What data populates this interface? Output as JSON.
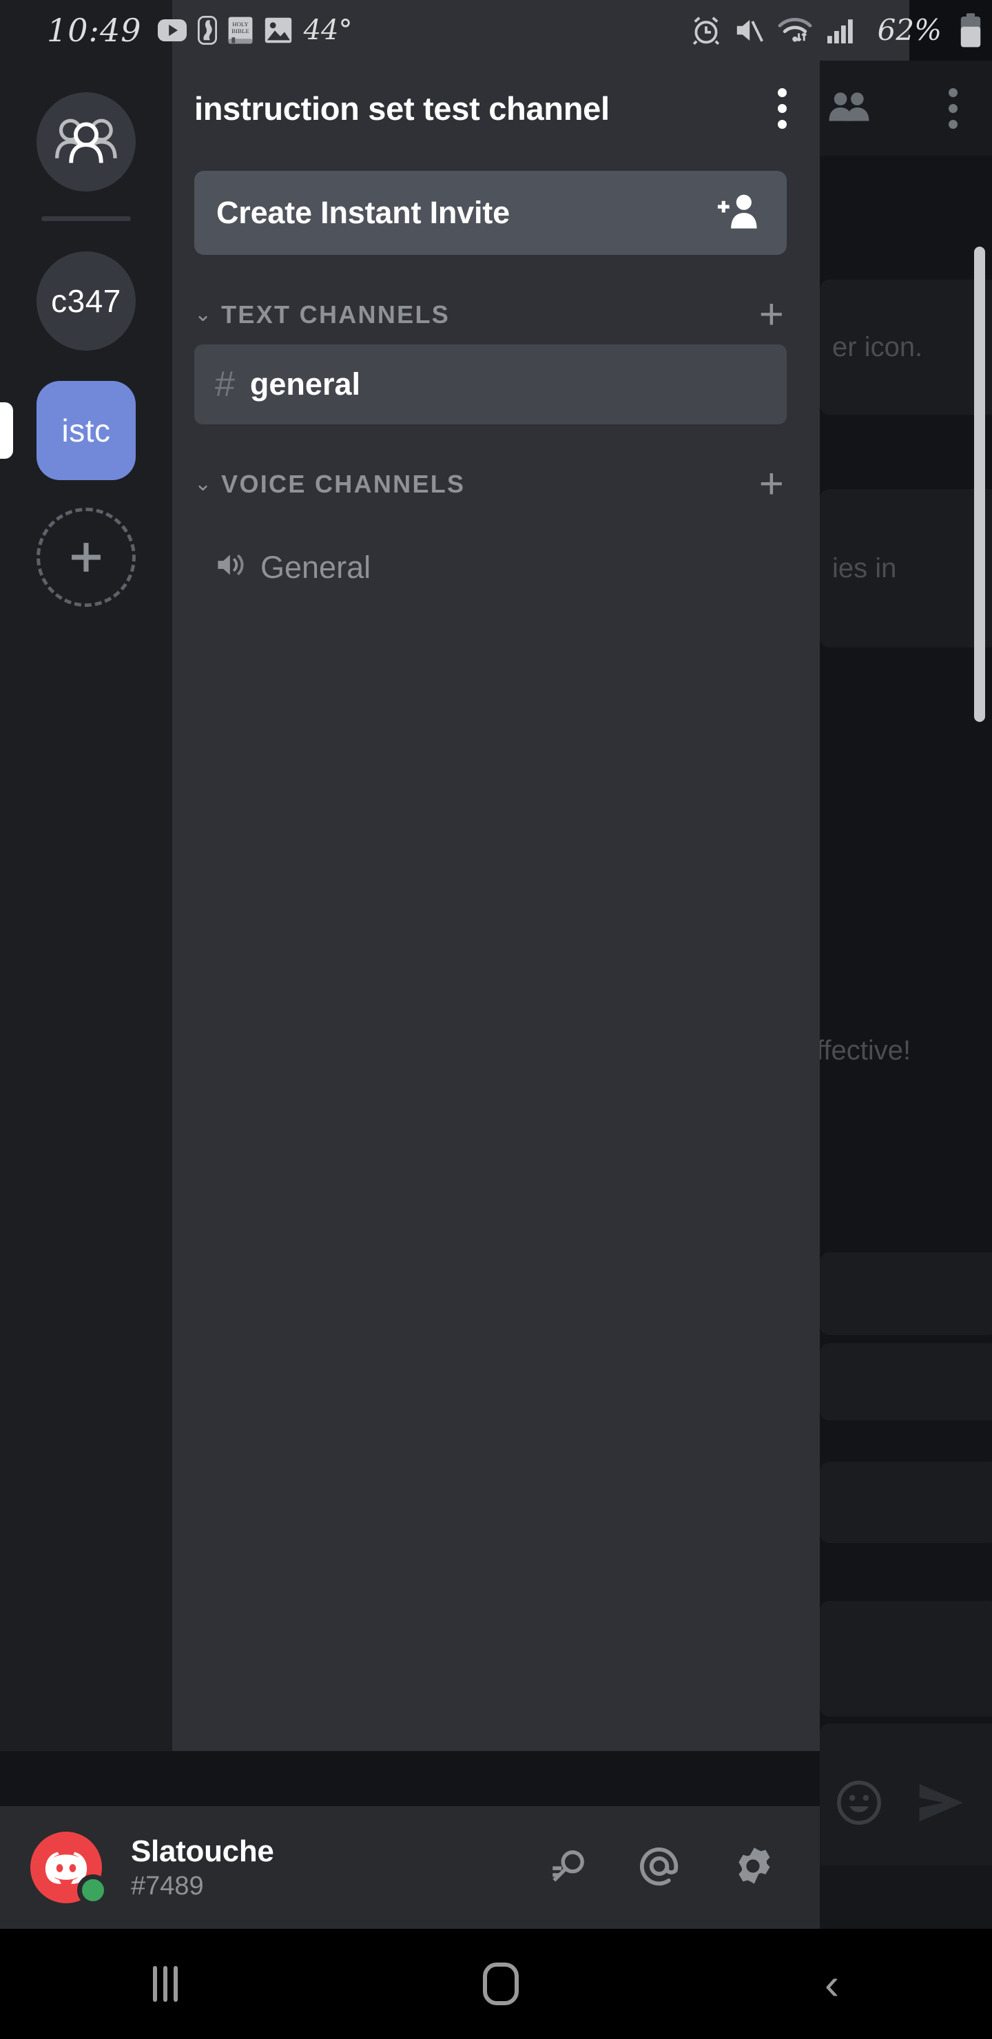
{
  "status_bar": {
    "time": "10:49",
    "temperature": "44°",
    "battery_percent": "62%",
    "left_icons": [
      "youtube-icon",
      "nba-icon",
      "holy-bible-icon",
      "gallery-icon"
    ],
    "right_icons": [
      "alarm-icon",
      "volume-mute-icon",
      "wifi-icon",
      "cellular-signal-icon",
      "battery-icon"
    ]
  },
  "server_rail": {
    "dm_label": "Direct Messages",
    "servers": [
      {
        "label": "c347",
        "active": false
      },
      {
        "label": "istc",
        "active": true
      }
    ],
    "add_server_label": "+"
  },
  "drawer": {
    "title": "instruction set test channel",
    "overflow_label": "More options",
    "invite": {
      "label": "Create Instant Invite",
      "icon": "person-add-icon"
    },
    "categories": [
      {
        "label": "TEXT CHANNELS",
        "chevron": "⌄",
        "add_label": "+",
        "channels": [
          {
            "name": "general",
            "prefix": "#",
            "selected": true
          }
        ]
      },
      {
        "label": "VOICE CHANNELS",
        "chevron": "⌄",
        "add_label": "+",
        "channels": [
          {
            "name": "General",
            "prefix": "speaker-icon",
            "selected": false
          }
        ]
      }
    ]
  },
  "user_bar": {
    "username": "Slatouche",
    "discriminator": "#7489",
    "presence": "online",
    "actions": [
      "search-icon",
      "mentions-icon",
      "settings-gear-icon"
    ]
  },
  "background_chat": {
    "header_icons": [
      "members-icon",
      "overflow-menu-icon"
    ],
    "visible_message_fragments": [
      "er icon.",
      "ies in",
      "ffective!"
    ],
    "composer_icons": [
      "emoji-icon",
      "send-icon"
    ]
  },
  "nav_bar": {
    "items": [
      "recents-button",
      "home-button",
      "back-button"
    ]
  },
  "colors": {
    "accent": "#7289da",
    "drawer_bg": "#2f3136",
    "rail_bg": "#1c1e22",
    "userbar_bg": "#292b2f",
    "online": "#3ba55d",
    "avatar": "#ed4245"
  }
}
